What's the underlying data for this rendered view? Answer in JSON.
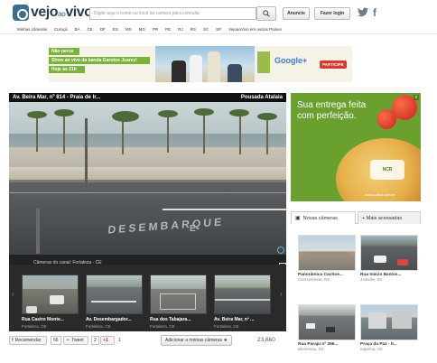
{
  "header": {
    "logo_text": "vejo",
    "logo_small": "ao",
    "logo_text2": "vivo",
    "search_placeholder": "Digite aqui o nome ou local da camera para consulta",
    "advertise_label": "Anuncie",
    "login_label": "Fazer login"
  },
  "nav": {
    "items": [
      "Minhas câmeras",
      "Curaçá",
      "BA",
      "CE",
      "DF",
      "ES",
      "MS",
      "MG",
      "PR",
      "PE",
      "RJ",
      "RS",
      "SC",
      "SP",
      "VejoaoVivo em outros Países"
    ]
  },
  "banner": {
    "lines": [
      "Não perca",
      "Show ao vivo da banda Garotos Juarez!",
      "Hoje às 21h"
    ],
    "google_label": "Google+",
    "cta_label": "PARTICIPE"
  },
  "player": {
    "title": "Av. Beira Mar, nº 814 - Praia de Ir...",
    "source": "Pousada Atalaia",
    "road_text": "DESEMBARQUE",
    "road_letter": "E",
    "video_caption": "Câmeras do canal: Fortaleza - CE",
    "thumbs": [
      {
        "title": "Rua Castro Monte...",
        "city": "Fortaleza, CE"
      },
      {
        "title": "Av. Desembargador...",
        "city": "Fortaleza, CE"
      },
      {
        "title": "Rua dos Tabajara...",
        "city": "Fortaleza, CE"
      },
      {
        "title": "Av. Beira Mar, nº ...",
        "city": "Fortaleza, CE"
      }
    ]
  },
  "social": {
    "recommend_label": "Recomendar",
    "recommend_count": "66",
    "tweet_label": "Tweet",
    "tweet_count": "2",
    "gplus_label": "+1",
    "gplus_count": "1",
    "add_label": "Adicionar a minhas câmeras ★",
    "views": "23,660"
  },
  "side_ad": {
    "headline": "Sua entrega feita com perfeição.",
    "logo": "NCR",
    "url": "www.colibri.com.br",
    "close": "x"
  },
  "tabs": {
    "new_label": "Novas câmeras",
    "popular_label": "+ Mais acessadas"
  },
  "cameras": [
    {
      "title": "Panorâmica Cachoe...",
      "city": "Cachoeirinha, RS"
    },
    {
      "title": "Rua Inácio Bastos...",
      "city": "Joinville, SC"
    },
    {
      "title": "Rua Paraju nº 356...",
      "city": "Blumenau, SC"
    },
    {
      "title": "Praça da Paz - It...",
      "city": "Itapema, SC"
    }
  ]
}
